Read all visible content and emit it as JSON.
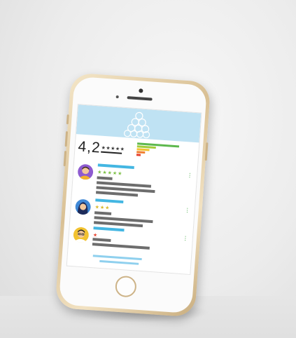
{
  "app": {
    "rating_value": "4,2",
    "rating_stars": "★★★★★",
    "histogram": [
      {
        "level": 5,
        "color": "#5db84d",
        "fill": 1.0
      },
      {
        "level": 4,
        "color": "#a2cd3a",
        "fill": 0.45
      },
      {
        "level": 3,
        "color": "#f2c230",
        "fill": 0.3
      },
      {
        "level": 2,
        "color": "#f07f30",
        "fill": 0.2
      },
      {
        "level": 1,
        "color": "#e6402d",
        "fill": 0.1
      }
    ],
    "reviews": [
      {
        "stars": "★★★★★",
        "star_color": "#7bc043",
        "avatar": "man-avatar"
      },
      {
        "stars": "★★★",
        "star_color": "#d9b82a",
        "avatar": "woman-hijab-avatar"
      },
      {
        "stars": "★",
        "star_color": "#e6402d",
        "avatar": "man-glasses-avatar"
      }
    ],
    "menu_icon": "⋮"
  }
}
